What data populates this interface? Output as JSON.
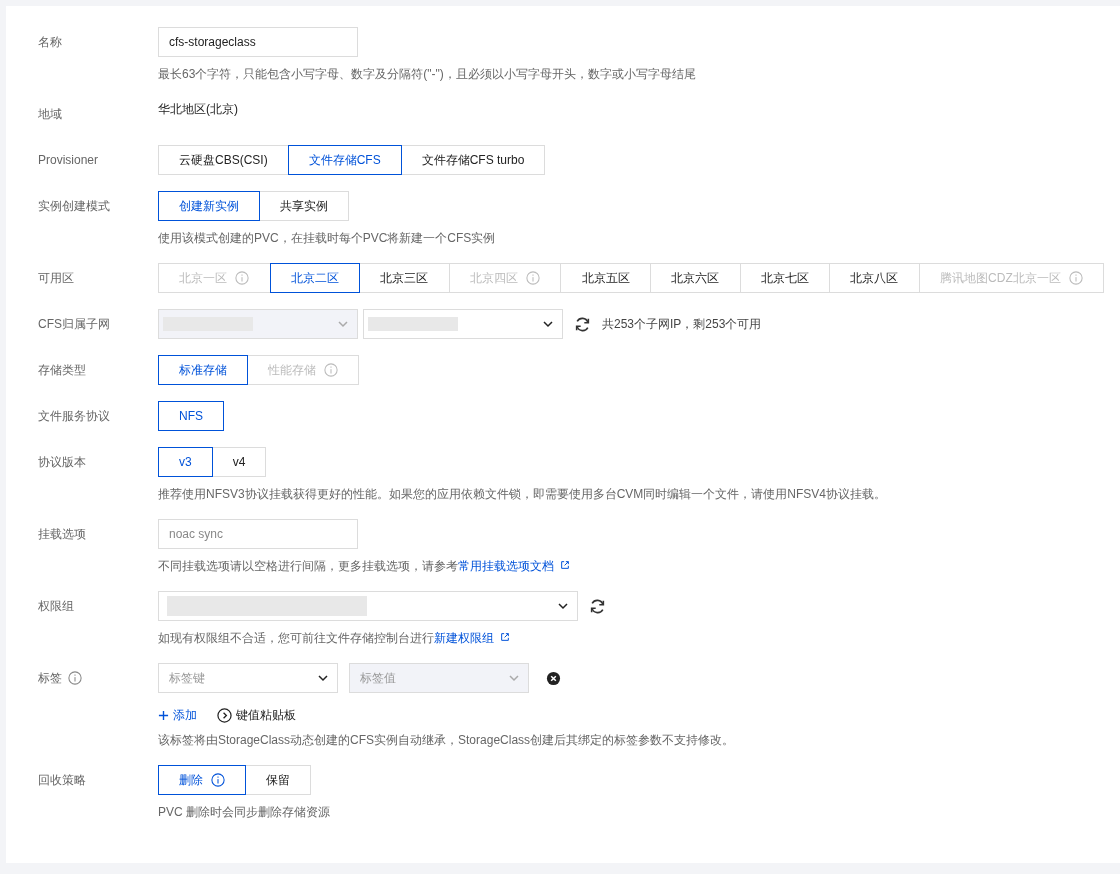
{
  "rows": [
    {
      "kind": "input",
      "label": "名称",
      "value": "cfs-storageclass",
      "hint": {
        "text": "最长63个字符，只能包含小写字母、数字及分隔符(\"-\")，且必须以小写字母开头，数字或小写字母结尾"
      }
    },
    {
      "kind": "text",
      "label": "地域",
      "value": "华北地区(北京)"
    },
    {
      "kind": "segmented",
      "label": "Provisioner",
      "options": [
        {
          "label": "云硬盘CBS(CSI)",
          "selected": false,
          "disabled": false,
          "info": false
        },
        {
          "label": "文件存储CFS",
          "selected": true,
          "disabled": false,
          "info": false
        },
        {
          "label": "文件存储CFS turbo",
          "selected": false,
          "disabled": false,
          "info": false
        }
      ]
    },
    {
      "kind": "segmented",
      "label": "实例创建模式",
      "options": [
        {
          "label": "创建新实例",
          "selected": true,
          "disabled": false,
          "info": false
        },
        {
          "label": "共享实例",
          "selected": false,
          "disabled": false,
          "info": false
        }
      ],
      "hint": {
        "text": "使用该模式创建的PVC，在挂载时每个PVC将新建一个CFS实例"
      }
    },
    {
      "kind": "zones",
      "label": "可用区",
      "options": [
        {
          "label": "北京一区",
          "selected": false,
          "disabled": true,
          "info": true
        },
        {
          "label": "北京二区",
          "selected": true,
          "disabled": false,
          "info": false
        },
        {
          "label": "北京三区",
          "selected": false,
          "disabled": false,
          "info": false
        },
        {
          "label": "北京四区",
          "selected": false,
          "disabled": true,
          "info": true
        },
        {
          "label": "北京五区",
          "selected": false,
          "disabled": false,
          "info": false
        },
        {
          "label": "北京六区",
          "selected": false,
          "disabled": false,
          "info": false
        },
        {
          "label": "北京七区",
          "selected": false,
          "disabled": false,
          "info": false
        },
        {
          "label": "北京八区",
          "selected": false,
          "disabled": false,
          "info": false
        },
        {
          "label": "腾讯地图CDZ北京一区",
          "selected": false,
          "disabled": true,
          "info": true
        }
      ]
    },
    {
      "kind": "subnet",
      "label": "CFS归属子网",
      "selects": [
        {
          "disabled": true
        },
        {
          "disabled": false
        }
      ],
      "note": "共253个子网IP，剩253个可用"
    },
    {
      "kind": "segmented",
      "label": "存储类型",
      "options": [
        {
          "label": "标准存储",
          "selected": true,
          "disabled": false,
          "info": false
        },
        {
          "label": "性能存储",
          "selected": false,
          "disabled": true,
          "info": true
        }
      ]
    },
    {
      "kind": "segmented",
      "label": "文件服务协议",
      "options": [
        {
          "label": "NFS",
          "selected": true,
          "disabled": false,
          "info": false
        }
      ]
    },
    {
      "kind": "segmented",
      "label": "协议版本",
      "options": [
        {
          "label": "v3",
          "selected": true,
          "disabled": false,
          "info": false
        },
        {
          "label": "v4",
          "selected": false,
          "disabled": false,
          "info": false
        }
      ],
      "hint": {
        "text": "推荐使用NFSV3协议挂载获得更好的性能。如果您的应用依赖文件锁，即需要使用多台CVM同时编辑一个文件，请使用NFSV4协议挂载。"
      }
    },
    {
      "kind": "input",
      "label": "挂载选项",
      "placeholder": "noac sync",
      "hint": {
        "text": "不同挂载选项请以空格进行间隔，更多挂载选项，请参考",
        "link": "常用挂载选项文档"
      }
    },
    {
      "kind": "select",
      "label": "权限组",
      "hint": {
        "text": "如现有权限组不合适，您可前往文件存储控制台进行",
        "link": "新建权限组"
      }
    },
    {
      "kind": "tags",
      "label": "标签",
      "label_info": true,
      "key": {
        "placeholder": "标签键",
        "disabled": false
      },
      "value": {
        "placeholder": "标签值",
        "disabled": true
      },
      "add": "添加",
      "paste": "键值粘贴板",
      "hint": {
        "text": "该标签将由StorageClass动态创建的CFS实例自动继承，StorageClass创建后其绑定的标签参数不支持修改。"
      }
    },
    {
      "kind": "segmented",
      "label": "回收策略",
      "options": [
        {
          "label": "删除",
          "selected": true,
          "disabled": false,
          "info": true
        },
        {
          "label": "保留",
          "selected": false,
          "disabled": false,
          "info": false
        }
      ],
      "hint": {
        "text": "PVC 删除时会同步删除存储资源"
      }
    }
  ]
}
